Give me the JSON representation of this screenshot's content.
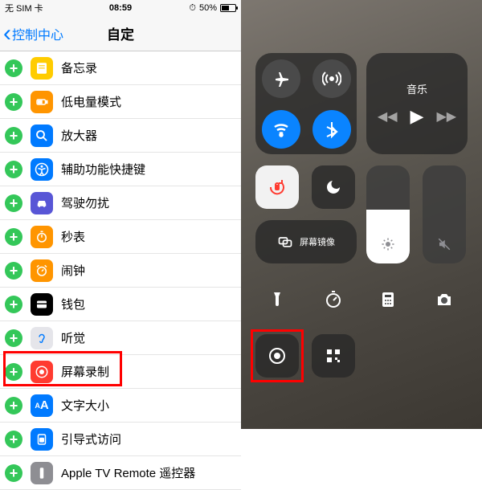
{
  "status": {
    "carrier": "无 SIM 卡",
    "time": "08:59",
    "battery_pct": "50%"
  },
  "nav": {
    "back": "控制中心",
    "title": "自定"
  },
  "rows": [
    {
      "label": "备忘录"
    },
    {
      "label": "低电量模式"
    },
    {
      "label": "放大器"
    },
    {
      "label": "辅助功能快捷键"
    },
    {
      "label": "驾驶勿扰"
    },
    {
      "label": "秒表"
    },
    {
      "label": "闹钟"
    },
    {
      "label": "钱包"
    },
    {
      "label": "听觉"
    },
    {
      "label": "屏幕录制"
    },
    {
      "label": "文字大小"
    },
    {
      "label": "引导式访问"
    },
    {
      "label": "Apple TV Remote 遥控器"
    }
  ],
  "cc": {
    "music_label": "音乐",
    "mirror_label": "屏幕镜像"
  }
}
